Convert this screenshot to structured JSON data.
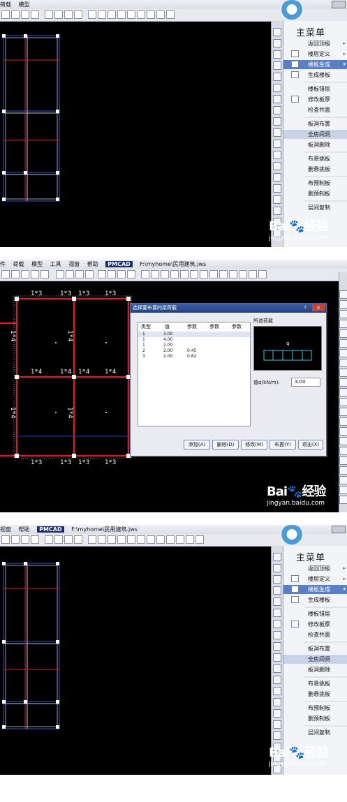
{
  "menubar": {
    "items_top": [
      "荷载",
      "模型"
    ],
    "items_full": [
      "件",
      "荷载",
      "模型",
      "工具",
      "视窗",
      "帮助"
    ],
    "items_bottom": [
      "视窗",
      "帮助"
    ],
    "app_tag": "PMCAD",
    "file_path": "F:\\myhome\\民用建筑.jws"
  },
  "menu": {
    "title": "主菜单",
    "items": [
      {
        "label": "返回顶级",
        "arrow": "▸"
      },
      {
        "label": "楼层定义",
        "arrow": "▸"
      },
      {
        "label": "楼板生成",
        "arrow": "▾"
      },
      {
        "label": "生成楼板",
        "arrow": ""
      },
      {
        "label": "楼板错层",
        "arrow": ""
      },
      {
        "label": "修改板厚",
        "arrow": ""
      },
      {
        "label": "检查共面",
        "arrow": ""
      },
      {
        "label": "板洞布置",
        "arrow": ""
      },
      {
        "label": "全房间洞",
        "arrow": ""
      },
      {
        "label": "板洞删除",
        "arrow": ""
      },
      {
        "label": "布悬挑板",
        "arrow": ""
      },
      {
        "label": "删悬挑板",
        "arrow": ""
      },
      {
        "label": "布预制板",
        "arrow": ""
      },
      {
        "label": "删预制板",
        "arrow": ""
      },
      {
        "label": "层间复制",
        "arrow": ""
      }
    ]
  },
  "drawing": {
    "beam_labels_top": [
      "1*3",
      "1*3",
      "1*3",
      "1*3"
    ],
    "beam_labels_mid": [
      "1*4",
      "1*4",
      "1*4",
      "1*4"
    ],
    "beam_labels_bottom": [
      "1*3",
      "1*3",
      "1*3",
      "1*3"
    ],
    "beam_labels_vertical": [
      "1*4",
      "1*4",
      "1*4",
      "1*4"
    ]
  },
  "dialog": {
    "title": "选择要布置的梁荷载",
    "controls": [
      "?",
      "×"
    ],
    "columns": [
      "类型",
      "值",
      "参数",
      "参数",
      "参数"
    ],
    "rows": [
      [
        "1",
        "3.00",
        "",
        "",
        ""
      ],
      [
        "1",
        "4.00",
        "",
        "",
        ""
      ],
      [
        "1",
        "2.00",
        "",
        "",
        ""
      ],
      [
        "2",
        "2.00",
        "0.45",
        "",
        ""
      ],
      [
        "3",
        "2.00",
        "0.82",
        "",
        ""
      ]
    ],
    "preview_label": "所选荷载",
    "preview_q": "q",
    "value_label": "值q(kN/m):",
    "value": "3.00",
    "buttons": [
      "添加(A)",
      "删除(D)",
      "修改(M)",
      "布置(Y)",
      "退出(X)"
    ]
  },
  "watermark": {
    "brand": "Bai",
    "brand_cn": "经验",
    "url": "jingyan.baidu.com"
  }
}
